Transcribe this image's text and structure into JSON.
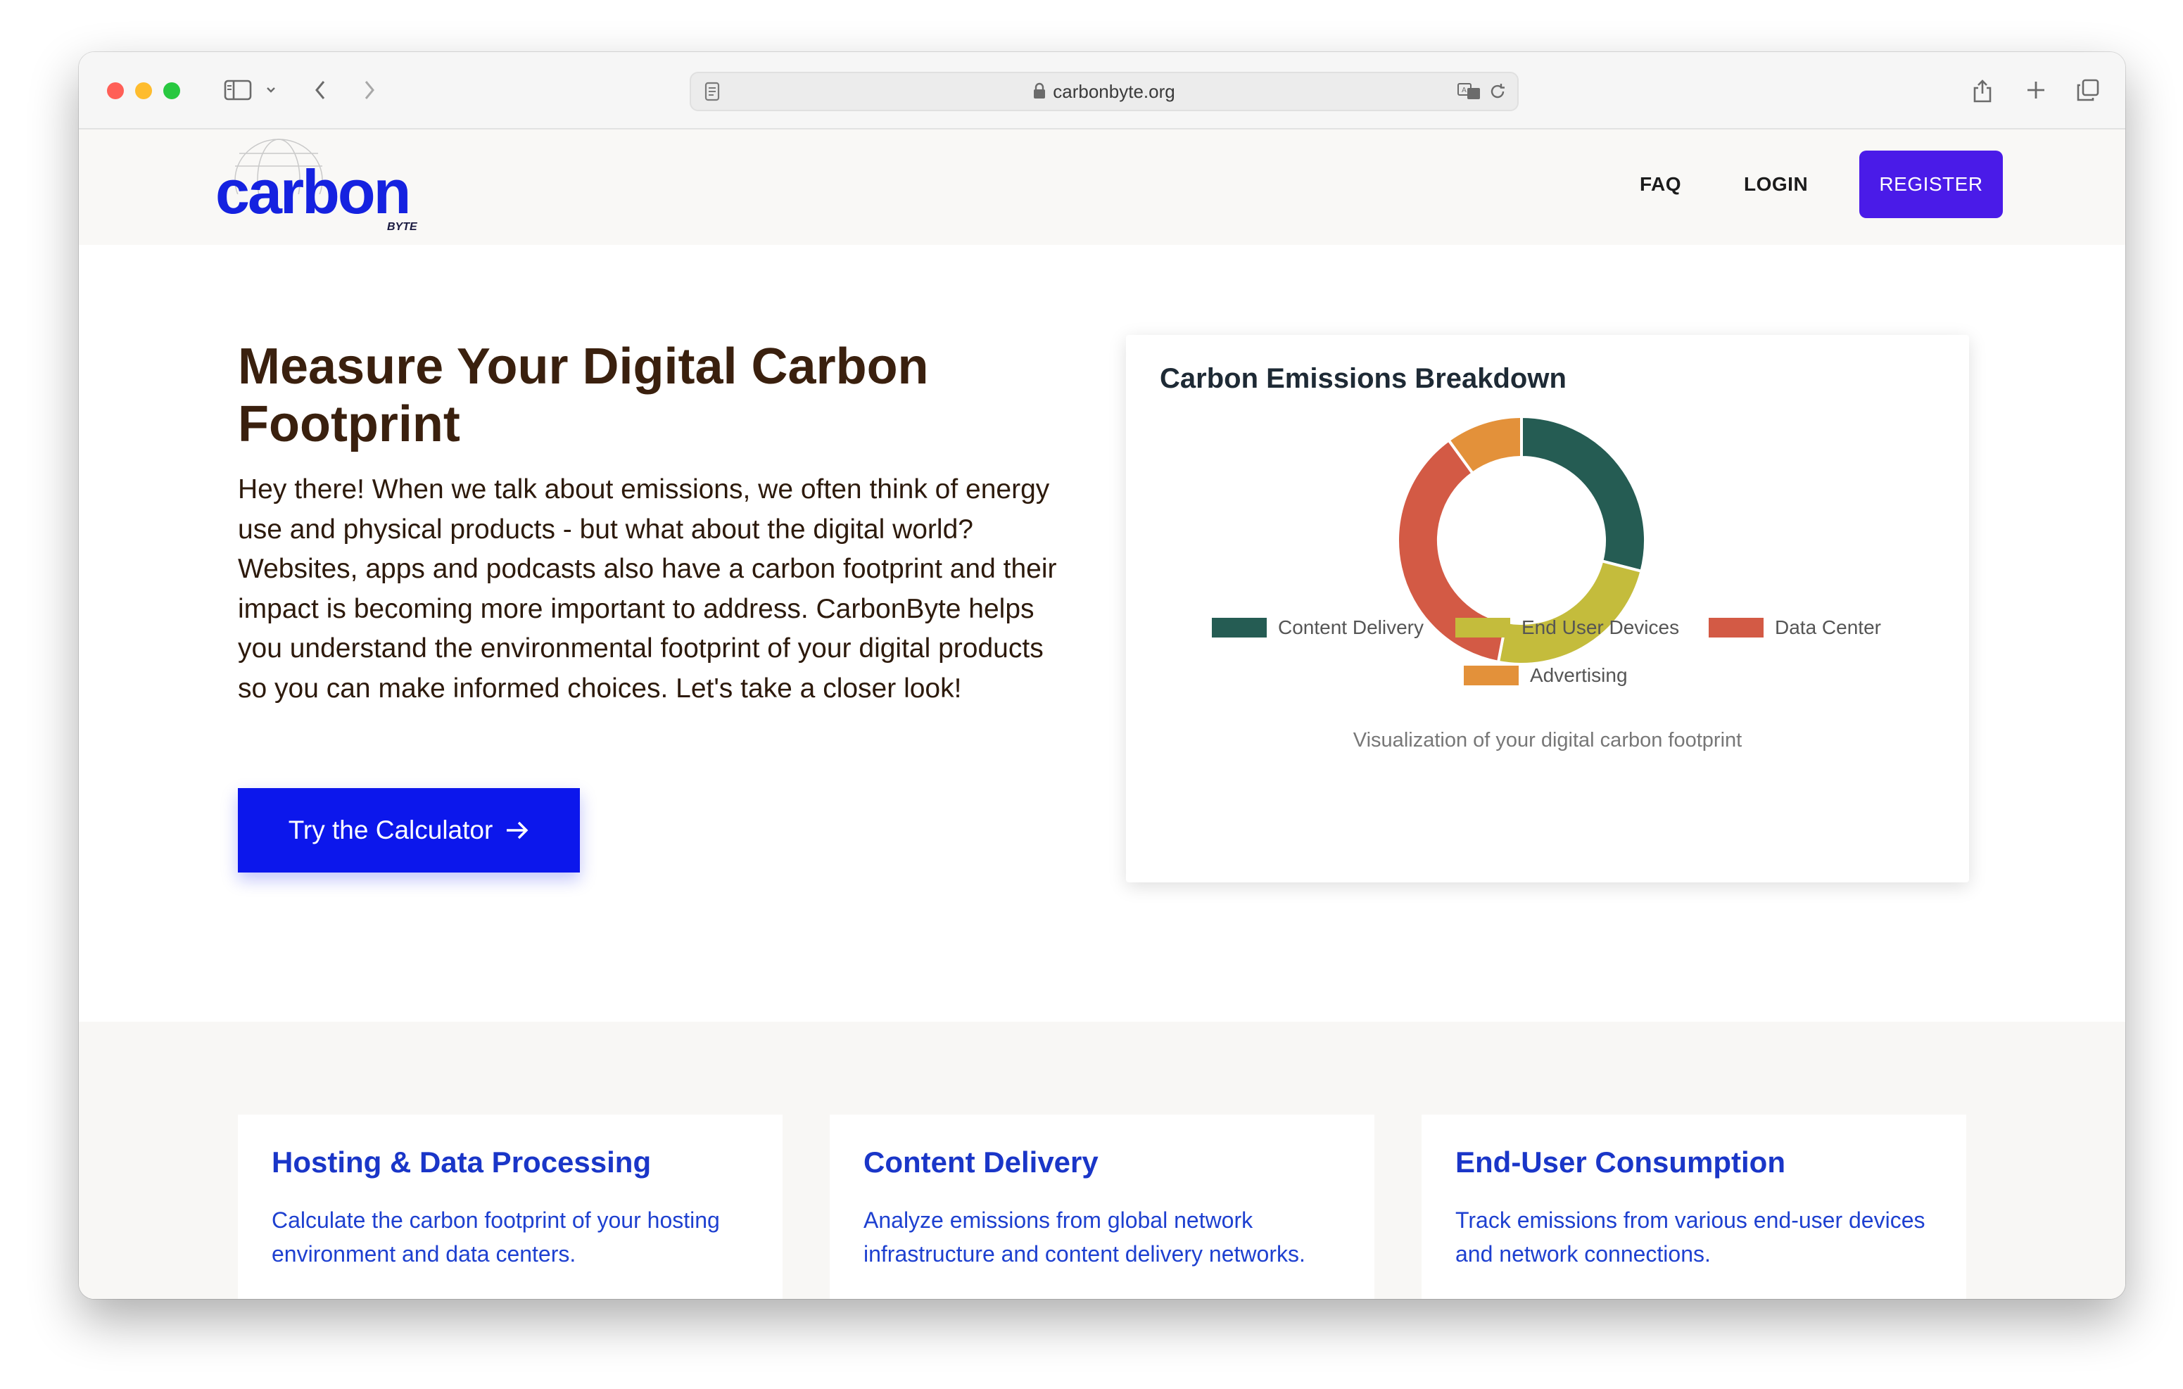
{
  "browser": {
    "url": "carbonbyte.org"
  },
  "site": {
    "logo_text": "carbon",
    "logo_sub": "BYTE",
    "nav": {
      "faq": "FAQ",
      "login": "LOGIN",
      "register": "REGISTER"
    }
  },
  "hero": {
    "title": "Measure Your Digital Carbon Footprint",
    "text": "Hey there! When we talk about emissions, we often think of energy use and physical products - but what about the digital world? Websites, apps and podcasts also have a carbon footprint and their impact is becoming more important to address. CarbonByte helps you understand the environmental footprint of your digital products so you can make informed choices. Let's take a closer look!",
    "cta_label": "Try the Calculator"
  },
  "chart_data": {
    "type": "pie",
    "variant": "donut",
    "title": "Carbon Emissions Breakdown",
    "categories": [
      "Content Delivery",
      "End User Devices",
      "Data Center",
      "Advertising"
    ],
    "values": [
      29,
      24,
      37,
      10
    ],
    "colors": [
      "#255c53",
      "#c4bc3c",
      "#d35a45",
      "#e3913a"
    ],
    "caption": "Visualization of your digital carbon footprint",
    "legend_position": "bottom"
  },
  "features": [
    {
      "title": "Hosting & Data Processing",
      "desc": "Calculate the carbon footprint of your hosting environment and data centers."
    },
    {
      "title": "Content Delivery",
      "desc": "Analyze emissions from global network infrastructure and content delivery networks."
    },
    {
      "title": "End-User Consumption",
      "desc": "Track emissions from various end-user devices and network connections."
    }
  ]
}
